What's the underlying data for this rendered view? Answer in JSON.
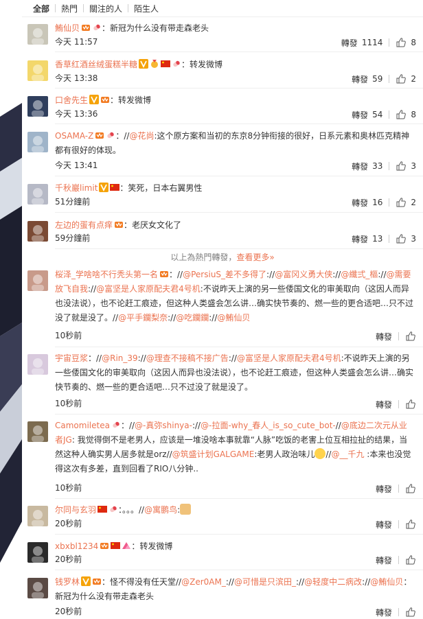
{
  "tabs": [
    "全部",
    "熱門",
    "關注的人",
    "陌生人"
  ],
  "labels": {
    "repost": "轉發",
    "hot_notice": "以上為熱門轉發，",
    "see_more": "查看更多»"
  },
  "colors": {
    "name": "#eb7350",
    "meta": "#333333",
    "muted": "#808080"
  },
  "items": [
    {
      "name": "鮪仙贝",
      "badges": [
        "vip-crown-icon",
        "pill-icon"
      ],
      "text": "：新冠为什么没有带走森老头",
      "time": "今天 11:57",
      "reposts": "1114",
      "likes": "8"
    },
    {
      "name": "香草红酒丝绒蛋糕半糖",
      "badges": [
        "v-badge-icon",
        "medal-icon",
        "flag-icon",
        "pill-icon"
      ],
      "text": "：转发微博",
      "time": "今天 13:38",
      "reposts": "59",
      "likes": "2"
    },
    {
      "name": "口舍先生",
      "badges": [
        "v-badge-icon",
        "vip-crown-icon"
      ],
      "text": "：转发微博",
      "time": "今天 13:36",
      "reposts": "54",
      "likes": "8"
    },
    {
      "name": "OSAMA-Z",
      "badges": [
        "vip-crown-icon",
        "pill-icon"
      ],
      "text_pre": "：//",
      "mention": "@花尚",
      "text": ":这个原方案和当初的东京8分钟衔接的很好，日系元素和奥林匹克精神都有很好的体现。",
      "time": "今天 13:41",
      "reposts": "33",
      "likes": "3"
    },
    {
      "name": "千秋巖limit",
      "badges": [
        "v-badge-icon",
        "flag-icon"
      ],
      "text": "：笑死，日本右翼男性",
      "time": "51分鐘前",
      "reposts": "16",
      "likes": "2"
    },
    {
      "name": "左边的蛋有点痒",
      "badges": [
        "vip-crown-icon"
      ],
      "text": "：老厌女文化了",
      "time": "59分鐘前",
      "reposts": "13",
      "likes": "3"
    },
    {
      "name": "桜泽_学啥啥不行秃头第一名",
      "badges": [
        "vip-crown-icon"
      ],
      "segments": [
        {
          "t": "：//"
        },
        {
          "m": "@PersiuS_差不多得了"
        },
        {
          "t": ":"
        },
        {
          "t": "//"
        },
        {
          "m": "@富冈义勇大侠"
        },
        {
          "t": "://"
        },
        {
          "m": "@纖弍_樞"
        },
        {
          "t": "://"
        },
        {
          "m": "@需要放飞自我"
        },
        {
          "t": "://"
        },
        {
          "m": "@富坚是人家原配夫君4号机"
        },
        {
          "t": ":不说昨天上演的另一些倭国文化的审美取向（这因人而异也没法说），也不论赶工痕迹，但这种人类盛会怎么讲…确实快节奏的、燃一些的更合适吧…只不过没了就是没了。//"
        },
        {
          "m": "@平手鑭梨奈"
        },
        {
          "t": "://"
        },
        {
          "m": "@吃鑭鑭"
        },
        {
          "t": "://"
        },
        {
          "m": "@鮪仙贝"
        }
      ],
      "time": "10秒前",
      "likes": ""
    },
    {
      "name": "宇宙豆浆",
      "badges": [],
      "segments": [
        {
          "t": "：//"
        },
        {
          "m": "@Rin_39"
        },
        {
          "t": "://"
        },
        {
          "m": "@理查不接稿不接广告"
        },
        {
          "t": "://"
        },
        {
          "m": "@富坚是人家原配夫君4号机"
        },
        {
          "t": ":不说昨天上演的另一些倭国文化的审美取向（这因人而异也没法说），也不论赶工痕迹，但这种人类盛会怎么讲…确实快节奏的、燃一些的更合适吧…只不过没了就是没了。"
        }
      ],
      "time": "10秒前",
      "likes": ""
    },
    {
      "name": "Camomiletea",
      "badges": [
        "pill-icon"
      ],
      "segments": [
        {
          "t": "：//"
        },
        {
          "m": "@-真弥shinya-"
        },
        {
          "t": "://"
        },
        {
          "m": "@-拉面-why_春人_is_so_cute_bot-"
        },
        {
          "t": "//"
        },
        {
          "m": "@底边二次元从业者JG"
        },
        {
          "t": ": 我觉得倒不是老男人，应该是一堆没啥本事就靠“人脉”吃饭的老害上位互相拉扯的结果，当然这种人确实男人居多就是orz//"
        },
        {
          "m": "@筑盛计划GALGAME"
        },
        {
          "t": ":老男人政治味儿"
        },
        {
          "e": "emoji"
        },
        {
          "t": "//"
        },
        {
          "m": "@__千九"
        },
        {
          "t": " :本来也没觉得这次有多差，直到回看了RIO八分钟.."
        }
      ],
      "time": "10秒前",
      "likes": ""
    },
    {
      "name": "尔同与玄羽",
      "badges": [
        "flag-icon",
        "pill-icon"
      ],
      "segments": [
        {
          "t": "：。。。//"
        },
        {
          "m": "@寓鹏鸟"
        },
        {
          "t": ":"
        },
        {
          "e": "pray"
        }
      ],
      "time": "20秒前",
      "likes": ""
    },
    {
      "name": "xbxbl1234",
      "badges": [
        "vip-crown-icon",
        "flag-icon",
        "mountain-icon"
      ],
      "text": "：转发微博",
      "time": "20秒前",
      "likes": ""
    },
    {
      "name": "钱罗林",
      "badges": [
        "v-badge-icon",
        "vip-crown-icon"
      ],
      "segments": [
        {
          "t": "：怪不得没有任天堂//"
        },
        {
          "m": "@Zer0AM_"
        },
        {
          "t": "://"
        },
        {
          "m": "@可惜是只滨田_"
        },
        {
          "t": "://"
        },
        {
          "m": "@轻度中二病改"
        },
        {
          "t": "://"
        },
        {
          "m": "@鮪仙贝"
        },
        {
          "t": "：新冠为什么没有带走森老头"
        }
      ],
      "time": "20秒前",
      "likes": ""
    }
  ]
}
